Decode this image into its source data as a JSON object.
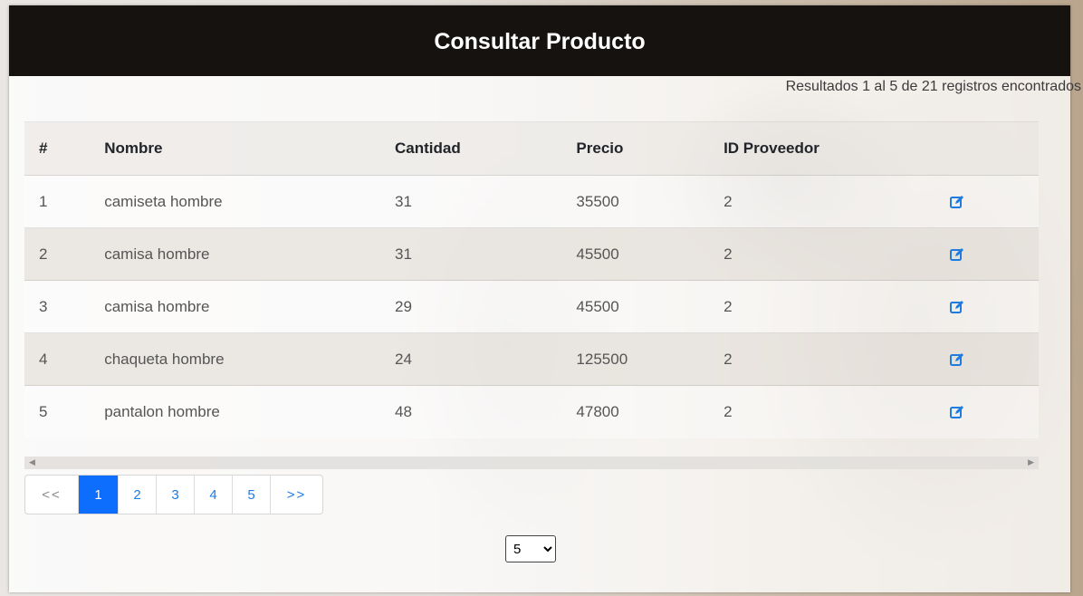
{
  "header": {
    "title": "Consultar Producto"
  },
  "results_text": "Resultados 1 al 5 de 21 registros encontrados",
  "table": {
    "columns": [
      "#",
      "Nombre",
      "Cantidad",
      "Precio",
      "ID Proveedor",
      ""
    ],
    "rows": [
      {
        "id": "1",
        "nombre": "camiseta hombre",
        "cantidad": "31",
        "precio": "35500",
        "proveedor": "2"
      },
      {
        "id": "2",
        "nombre": "camisa hombre",
        "cantidad": "31",
        "precio": "45500",
        "proveedor": "2"
      },
      {
        "id": "3",
        "nombre": "camisa hombre",
        "cantidad": "29",
        "precio": "45500",
        "proveedor": "2"
      },
      {
        "id": "4",
        "nombre": "chaqueta hombre",
        "cantidad": "24",
        "precio": "125500",
        "proveedor": "2"
      },
      {
        "id": "5",
        "nombre": "pantalon hombre",
        "cantidad": "48",
        "precio": "47800",
        "proveedor": "2"
      }
    ],
    "row_action_icon": "edit-icon"
  },
  "pagination": {
    "prev": "<<",
    "pages": [
      "1",
      "2",
      "3",
      "4",
      "5"
    ],
    "active_page": "1",
    "next": ">>"
  },
  "page_size": {
    "selected": "5",
    "options": [
      "5"
    ]
  },
  "colors": {
    "header_bg": "#161210",
    "link": "#1e7be0",
    "active_page": "#0d6efd"
  }
}
